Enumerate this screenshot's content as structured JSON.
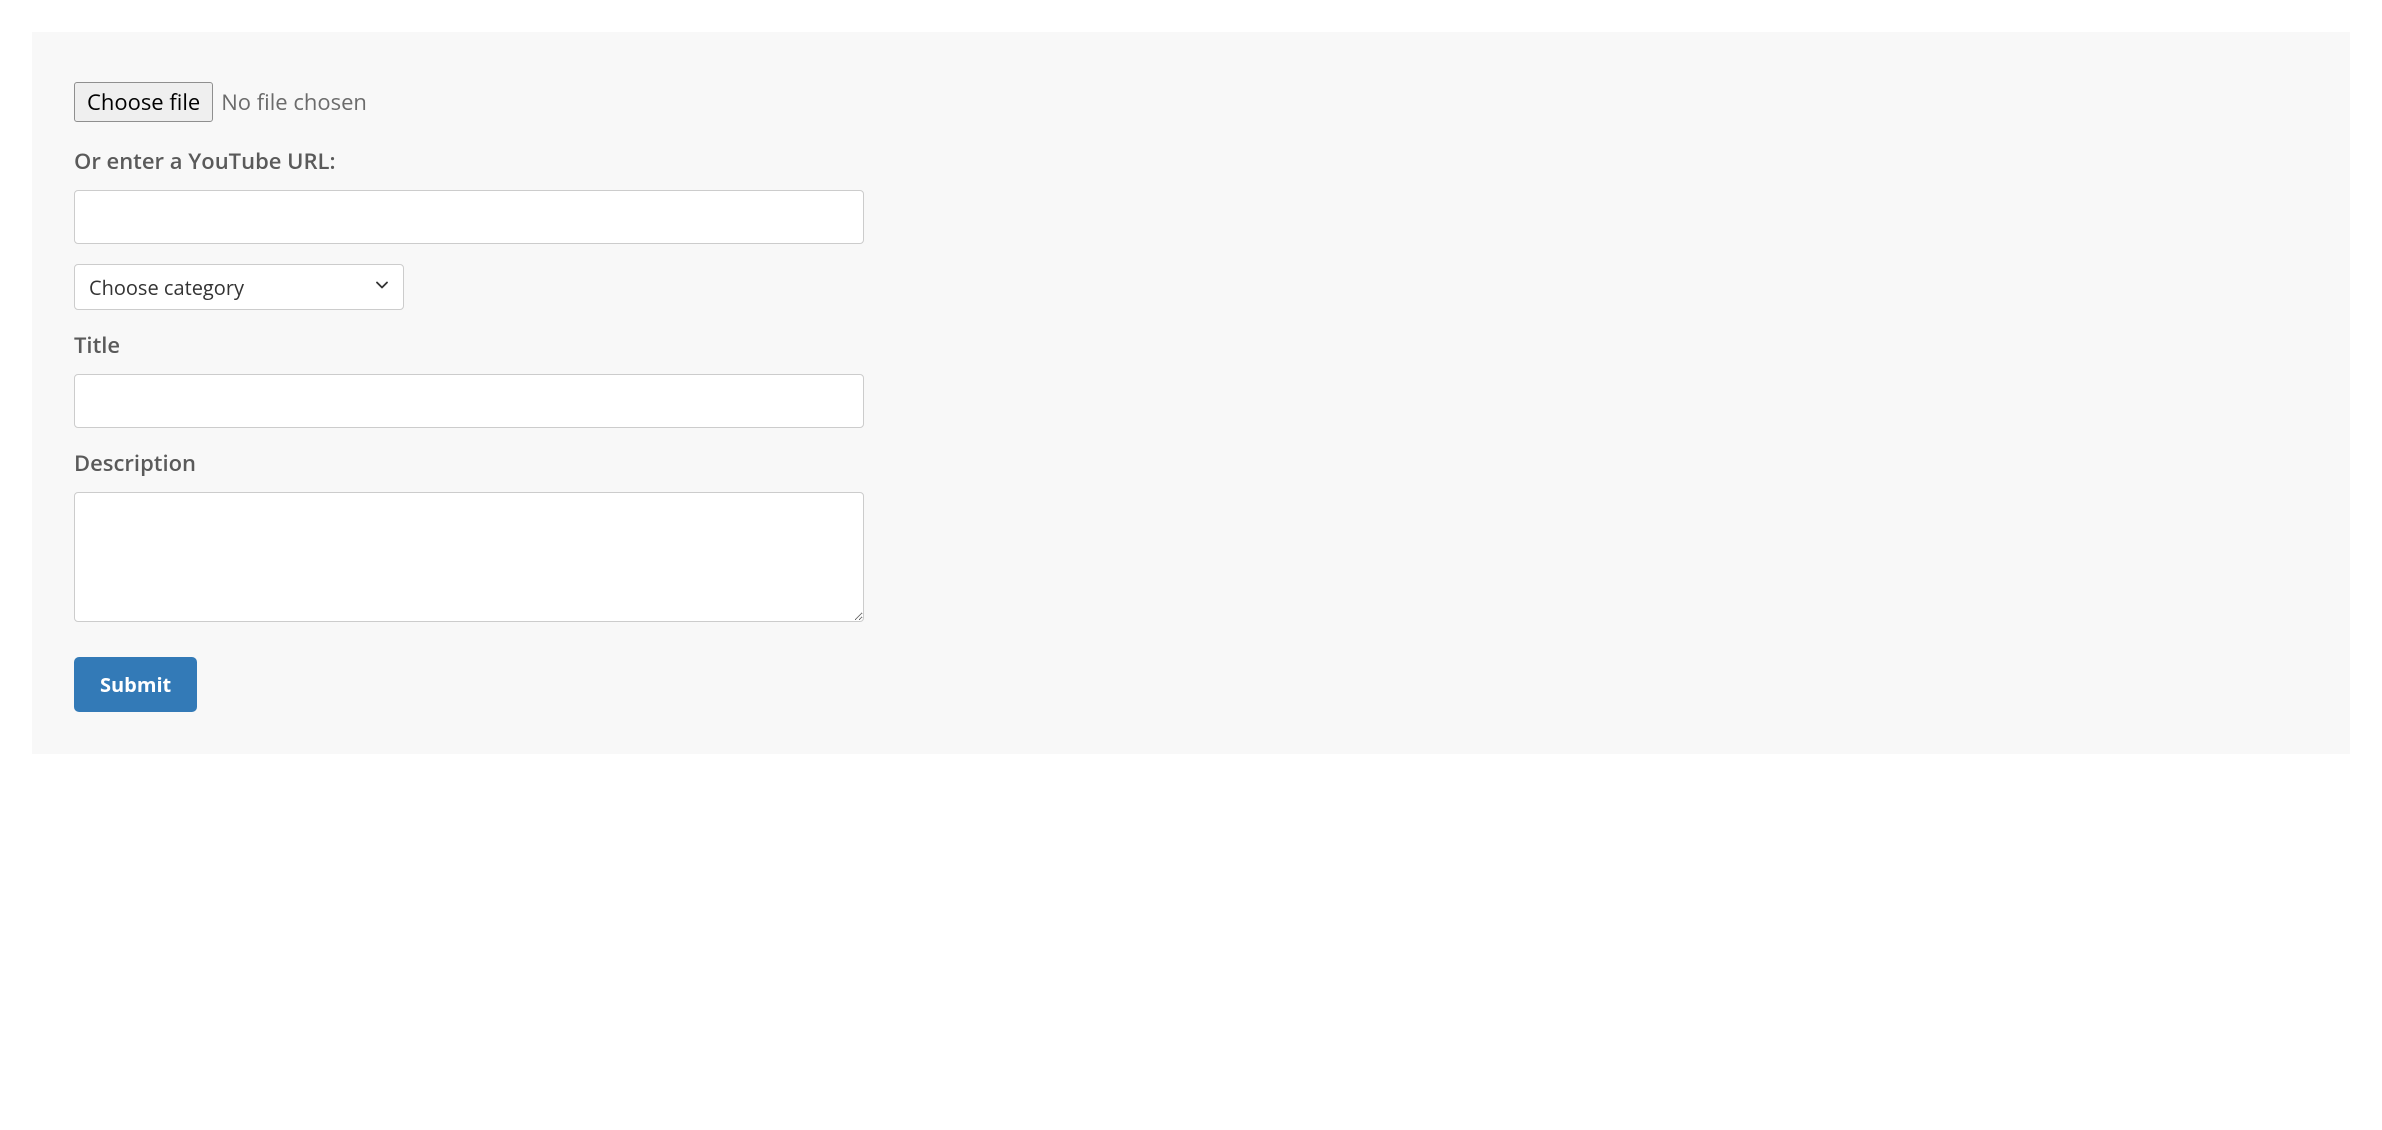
{
  "form": {
    "file_button_label": "Choose file",
    "file_status": "No file chosen",
    "youtube_label": "Or enter a YouTube URL:",
    "youtube_value": "",
    "category_placeholder": "Choose category",
    "title_label": "Title",
    "title_value": "",
    "description_label": "Description",
    "description_value": "",
    "submit_label": "Submit"
  }
}
